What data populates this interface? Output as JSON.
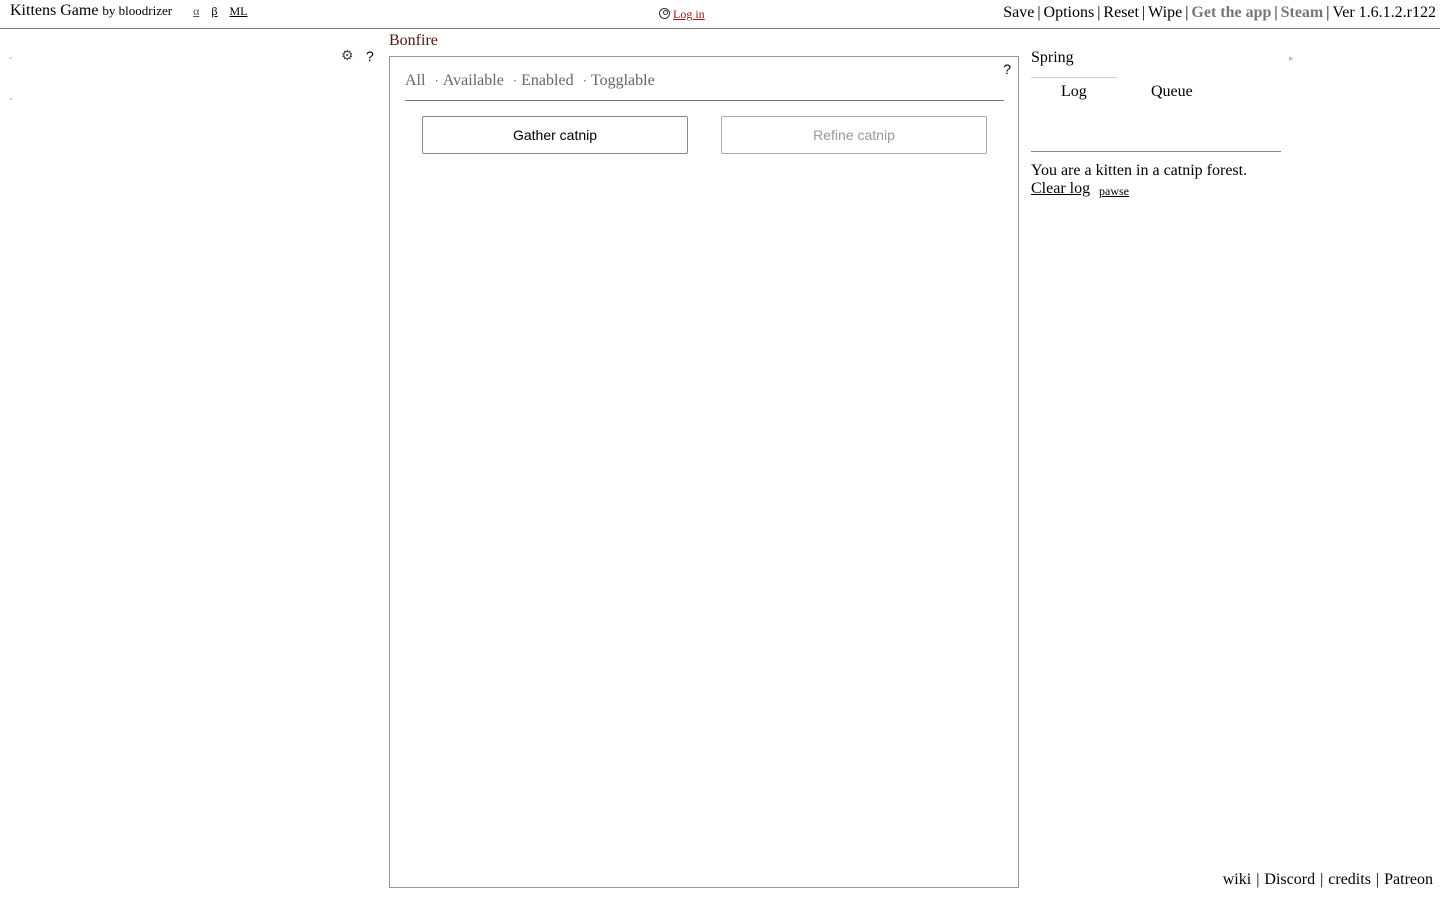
{
  "header": {
    "title": "Kittens Game",
    "byline": "by bloodrizer",
    "alpha_link": "α",
    "beta_link": "β",
    "ml_link": "ML",
    "login_label": "Log in",
    "menu": {
      "save": "Save",
      "options": "Options",
      "reset": "Reset",
      "wipe": "Wipe",
      "get_app": "Get the app",
      "steam": "Steam",
      "version": "Ver 1.6.1.2.r122",
      "separator": "|"
    }
  },
  "left": {
    "help": "?"
  },
  "center": {
    "tab_title": "Bonfire",
    "help": "?",
    "filters": {
      "all": "All",
      "available": "Available",
      "enabled": "Enabled",
      "togglable": "Togglable",
      "dot": "·"
    },
    "buttons": {
      "gather": "Gather catnip",
      "refine": "Refine catnip"
    }
  },
  "right": {
    "season": "Spring",
    "tabs": {
      "log": "Log",
      "queue": "Queue"
    },
    "log_message": "You are a kitten in a catnip forest.",
    "clear_log": "Clear log",
    "pause": "pawse"
  },
  "footer": {
    "wiki": "wiki",
    "discord": "Discord",
    "credits": "credits",
    "patreon": "Patreon",
    "separator": "|"
  },
  "icons": {
    "gear": "gear-icon",
    "user": "user-circle-icon",
    "chevron": "chevron-down-icon",
    "resize": "resize-handle-icon"
  },
  "colors": {
    "tab_title": "#5a1010",
    "login_link": "#b01010",
    "muted_link": "#777777"
  }
}
